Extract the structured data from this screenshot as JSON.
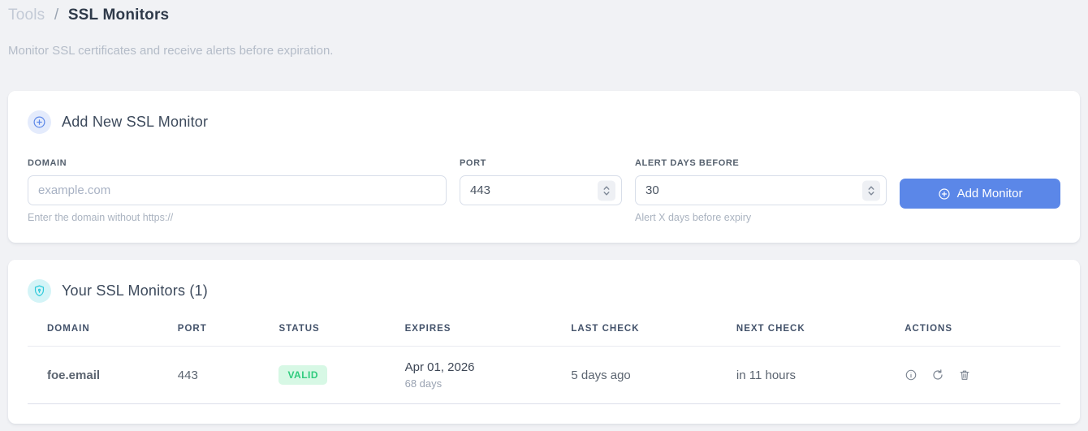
{
  "breadcrumb": {
    "parent": "Tools",
    "separator": "/",
    "current": "SSL Monitors"
  },
  "subtitle": "Monitor SSL certificates and receive alerts before expiration.",
  "add_monitor": {
    "title": "Add New SSL Monitor",
    "fields": {
      "domain": {
        "label": "DOMAIN",
        "placeholder": "example.com",
        "helper": "Enter the domain without https://"
      },
      "port": {
        "label": "PORT",
        "value": "443"
      },
      "alert_days": {
        "label": "ALERT DAYS BEFORE",
        "value": "30",
        "helper": "Alert X days before expiry"
      }
    },
    "submit_label": "Add Monitor"
  },
  "monitors_panel": {
    "title": "Your SSL Monitors (1)",
    "columns": [
      "DOMAIN",
      "PORT",
      "STATUS",
      "EXPIRES",
      "LAST CHECK",
      "NEXT CHECK",
      "ACTIONS"
    ],
    "rows": [
      {
        "domain": "foe.email",
        "port": "443",
        "status": "VALID",
        "expires_date": "Apr 01, 2026",
        "expires_days": "68 days",
        "last_check": "5 days ago",
        "next_check": "in 11 hours"
      }
    ]
  },
  "colors": {
    "accent_blue": "#5b87e8",
    "cyan_accent": "#2cc9da",
    "badge_green_bg": "#d7f8e5",
    "badge_green_text": "#2fcb7d",
    "page_background": "#f1f2f5"
  },
  "icons": {
    "header_add": "plus-circle-icon",
    "header_monitors": "shield-icon",
    "row_actions": [
      "info-icon",
      "refresh-icon",
      "trash-icon"
    ]
  }
}
